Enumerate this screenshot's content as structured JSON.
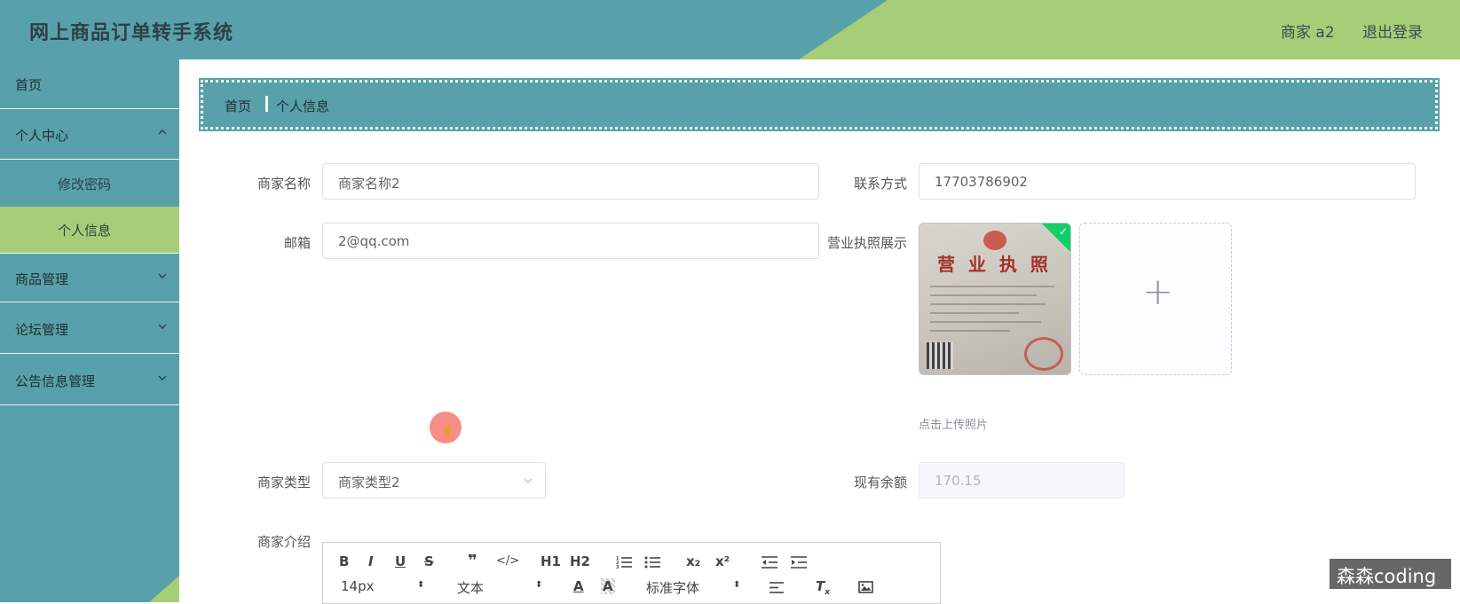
{
  "header": {
    "title": "网上商品订单转手系统",
    "user_label": "商家 a2",
    "logout_label": "退出登录"
  },
  "sidebar": {
    "items": [
      {
        "label": "首页"
      },
      {
        "label": "个人中心"
      },
      {
        "label": "修改密码"
      },
      {
        "label": "个人信息"
      },
      {
        "label": "商品管理"
      },
      {
        "label": "论坛管理"
      },
      {
        "label": "公告信息管理"
      }
    ],
    "active": "个人信息"
  },
  "breadcrumb": {
    "home": "首页",
    "current": "个人信息"
  },
  "form": {
    "name_label": "商家名称",
    "name_value": "商家名称2",
    "contact_label": "联系方式",
    "contact_value": "17703786902",
    "email_label": "邮箱",
    "email_value": "2@qq.com",
    "license_label": "营业执照展示",
    "license_image_text": "营 业 执 照",
    "upload_tip": "点击上传照片",
    "type_label": "商家类型",
    "type_value": "商家类型2",
    "balance_label": "现有余额",
    "balance_value": "170.15",
    "intro_label": "商家介绍"
  },
  "editor_toolbar": {
    "row1": [
      "B",
      "I",
      "U",
      "S",
      "❞",
      "</>",
      "H1",
      "H2",
      "ordered-list",
      "bullet-list",
      "x₂",
      "x²",
      "outdent",
      "indent"
    ],
    "font_size": "14px",
    "header_select": "文本",
    "font_family": "标准字体"
  },
  "watermark": "森森coding",
  "colors": {
    "primary": "#58a1aa",
    "accent": "#a6ce78"
  }
}
